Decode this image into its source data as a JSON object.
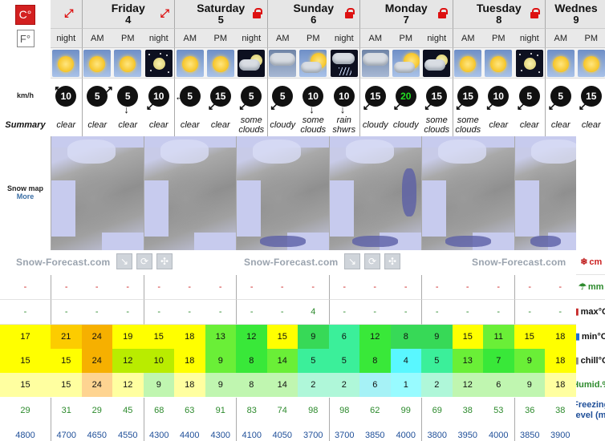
{
  "units": {
    "celsius": "C°",
    "fahrenheit": "F°"
  },
  "labels": {
    "wind": "km/h",
    "summary": "Summary",
    "snow_map": "Snow map",
    "more": "More",
    "snow": "cm",
    "rain": "mm",
    "max": "max°C",
    "min": "min°C",
    "chill": "chill°C",
    "humid": "Humid.%",
    "freezing": "Freezing level (m)"
  },
  "days": [
    {
      "name": "Friday",
      "date": "4",
      "icon": "expand-arrows-icon",
      "span": 3
    },
    {
      "name": "Saturday",
      "date": "5",
      "icon": "lock-icon",
      "span": 3
    },
    {
      "name": "Sunday",
      "date": "6",
      "icon": "lock-icon",
      "span": 3
    },
    {
      "name": "Monday",
      "date": "7",
      "icon": "lock-icon",
      "span": 3
    },
    {
      "name": "Tuesday",
      "date": "8",
      "icon": "lock-icon",
      "span": 3
    },
    {
      "name": "Wednes",
      "date": "9",
      "icon": "",
      "span": 2
    }
  ],
  "brand": "Snow-Forecast.com",
  "columns": [
    {
      "tod": "night",
      "wx": "clear-day",
      "wind": "10",
      "dir": "↖",
      "summary": "clear",
      "snow": "-",
      "rain": "-",
      "max": "17",
      "min": "15",
      "chill": "15",
      "humid": "29",
      "frz": "4800",
      "maxc": "bg-yellow",
      "minc": "bg-yellow",
      "chillc": "bg-pale"
    },
    {
      "tod": "AM",
      "wx": "clear-day",
      "wind": "5",
      "dir": "↗",
      "summary": "clear",
      "snow": "-",
      "rain": "-",
      "max": "21",
      "min": "15",
      "chill": "15",
      "humid": "31",
      "frz": "4700",
      "maxc": "bg-orange1",
      "minc": "bg-yellow",
      "chillc": "bg-pale"
    },
    {
      "tod": "PM",
      "wx": "clear-day",
      "wind": "5",
      "dir": "↓",
      "summary": "clear",
      "snow": "-",
      "rain": "-",
      "max": "24",
      "min": "24",
      "chill": "24",
      "humid": "29",
      "frz": "4650",
      "maxc": "bg-orange2",
      "minc": "bg-orange2",
      "chillc": "bg-peach"
    },
    {
      "tod": "night",
      "wx": "clear-night",
      "wind": "10",
      "dir": "↙",
      "summary": "clear",
      "snow": "-",
      "rain": "-",
      "max": "19",
      "min": "12",
      "chill": "12",
      "humid": "45",
      "frz": "4550",
      "maxc": "bg-yellow",
      "minc": "bg-ylgreen",
      "chillc": "bg-pale"
    },
    {
      "tod": "AM",
      "wx": "clear-day",
      "wind": "5",
      "dir": "←",
      "summary": "clear",
      "snow": "-",
      "rain": "-",
      "max": "15",
      "min": "10",
      "chill": "9",
      "humid": "68",
      "frz": "4300",
      "maxc": "bg-yellow",
      "minc": "bg-ylgreen",
      "chillc": "bg-lgreen"
    },
    {
      "tod": "PM",
      "wx": "clear-day",
      "wind": "15",
      "dir": "↙",
      "summary": "clear",
      "snow": "-",
      "rain": "-",
      "max": "18",
      "min": "18",
      "chill": "18",
      "humid": "63",
      "frz": "4400",
      "maxc": "bg-yellow",
      "minc": "bg-yellow",
      "chillc": "bg-pale"
    },
    {
      "tod": "night",
      "wx": "cloud-night",
      "wind": "5",
      "dir": "↙",
      "summary": "some clouds",
      "snow": "-",
      "rain": "-",
      "max": "13",
      "min": "9",
      "chill": "9",
      "humid": "91",
      "frz": "4300",
      "maxc": "bg-green2",
      "minc": "bg-green2",
      "chillc": "bg-lgreen"
    },
    {
      "tod": "AM",
      "wx": "overcast",
      "wind": "5",
      "dir": "↙",
      "summary": "cloudy",
      "snow": "-",
      "rain": "-",
      "max": "12",
      "min": "8",
      "chill": "8",
      "humid": "83",
      "frz": "4100",
      "maxc": "bg-green",
      "minc": "bg-green",
      "chillc": "bg-lgreen"
    },
    {
      "tod": "PM",
      "wx": "cloud-day",
      "wind": "10",
      "dir": "↓",
      "summary": "some clouds",
      "snow": "-",
      "rain": "-",
      "max": "15",
      "min": "14",
      "chill": "14",
      "humid": "74",
      "frz": "4050",
      "maxc": "bg-yellow",
      "minc": "bg-green2",
      "chillc": "bg-lgreen"
    },
    {
      "tod": "night",
      "wx": "rain-night",
      "wind": "10",
      "dir": "↓",
      "summary": "rain shwrs",
      "snow": "-",
      "rain": "4",
      "max": "9",
      "min": "5",
      "chill": "2",
      "humid": "98",
      "frz": "3700",
      "maxc": "bg-green3",
      "minc": "bg-mint",
      "chillc": "bg-lmint"
    },
    {
      "tod": "AM",
      "wx": "overcast",
      "wind": "15",
      "dir": "↙",
      "summary": "cloudy",
      "snow": "-",
      "rain": "-",
      "max": "6",
      "min": "5",
      "chill": "2",
      "humid": "98",
      "frz": "3700",
      "maxc": "bg-mint",
      "minc": "bg-mint",
      "chillc": "bg-lmint"
    },
    {
      "tod": "PM",
      "wx": "cloud-day",
      "wind": "20",
      "dir": "↙",
      "summary": "cloudy",
      "snow": "-",
      "rain": "-",
      "max": "12",
      "min": "8",
      "chill": "6",
      "humid": "62",
      "frz": "3850",
      "maxc": "bg-green",
      "minc": "bg-green",
      "chillc": "bg-lteal"
    },
    {
      "tod": "night",
      "wx": "cloud-night",
      "wind": "15",
      "dir": "↙",
      "summary": "some clouds",
      "snow": "-",
      "rain": "-",
      "max": "8",
      "min": "4",
      "chill": "1",
      "humid": "99",
      "frz": "4000",
      "maxc": "bg-green3",
      "minc": "bg-cyan",
      "chillc": "bg-cyanp"
    },
    {
      "tod": "AM",
      "wx": "clear-day",
      "wind": "15",
      "dir": "↙",
      "summary": "some clouds",
      "snow": "-",
      "rain": "-",
      "max": "9",
      "min": "5",
      "chill": "2",
      "humid": "69",
      "frz": "3800",
      "maxc": "bg-green3",
      "minc": "bg-mint",
      "chillc": "bg-lmint"
    },
    {
      "tod": "PM",
      "wx": "clear-day",
      "wind": "10",
      "dir": "↙",
      "summary": "clear",
      "snow": "-",
      "rain": "-",
      "max": "15",
      "min": "13",
      "chill": "12",
      "humid": "38",
      "frz": "3950",
      "maxc": "bg-yellow",
      "minc": "bg-green2",
      "chillc": "bg-lgreen"
    },
    {
      "tod": "night",
      "wx": "clear-night-moon",
      "wind": "5",
      "dir": "↙",
      "summary": "clear",
      "snow": "-",
      "rain": "-",
      "max": "11",
      "min": "7",
      "chill": "6",
      "humid": "53",
      "frz": "4000",
      "maxc": "bg-green2",
      "minc": "bg-green",
      "chillc": "bg-lgreen"
    },
    {
      "tod": "AM",
      "wx": "clear-day",
      "wind": "5",
      "dir": "↙",
      "summary": "clear",
      "snow": "-",
      "rain": "-",
      "max": "15",
      "min": "9",
      "chill": "9",
      "humid": "36",
      "frz": "3850",
      "maxc": "bg-yellow",
      "minc": "bg-green2",
      "chillc": "bg-lgreen"
    },
    {
      "tod": "PM",
      "wx": "clear-day",
      "wind": "15",
      "dir": "↙",
      "summary": "clear",
      "snow": "-",
      "rain": "-",
      "max": "18",
      "min": "18",
      "chill": "18",
      "humid": "38",
      "frz": "3900",
      "maxc": "bg-yellow",
      "minc": "bg-yellow",
      "chillc": "bg-pale"
    }
  ]
}
